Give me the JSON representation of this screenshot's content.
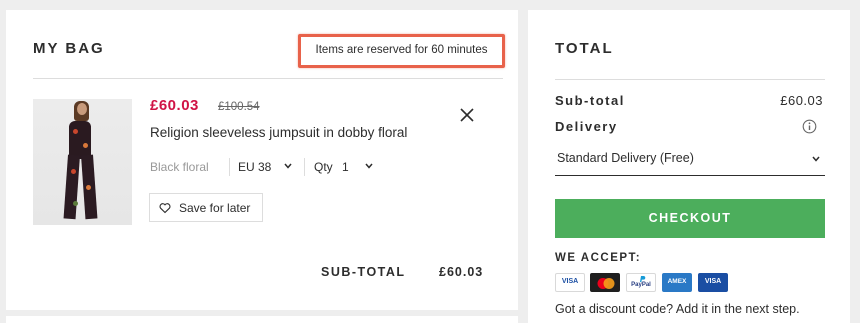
{
  "bag": {
    "title": "MY BAG",
    "reservation_notice": "Items are reserved for 60 minutes",
    "item": {
      "price": "£60.03",
      "original_price": "£100.54",
      "name": "Religion sleeveless jumpsuit in dobby floral",
      "colour": "Black floral",
      "size": "EU 38",
      "quantity_label": "Qty",
      "quantity": "1",
      "save_label": "Save for later"
    },
    "subtotal_label": "SUB-TOTAL",
    "subtotal_value": "£60.03"
  },
  "total": {
    "title": "TOTAL",
    "subtotal_label": "Sub-total",
    "subtotal_value": "£60.03",
    "delivery_label": "Delivery",
    "delivery_option": "Standard Delivery (Free)",
    "checkout_label": "CHECKOUT",
    "accept_label": "WE ACCEPT:",
    "cards": [
      {
        "name": "visa",
        "label": "VISA"
      },
      {
        "name": "mastercard",
        "label": ""
      },
      {
        "name": "paypal",
        "label": "PayPal"
      },
      {
        "name": "amex",
        "label": "AMEX"
      },
      {
        "name": "visa-electron",
        "label": "VISA"
      }
    ],
    "discount_text": "Got a discount code? Add it in the next step."
  },
  "colors": {
    "accent_price": "#d01345",
    "checkout_green": "#4cae5c",
    "highlight_border": "#e8624a",
    "page_bg": "#eeeeee"
  },
  "icons": [
    "close-icon",
    "chevron-down-icon",
    "heart-icon",
    "info-icon"
  ]
}
